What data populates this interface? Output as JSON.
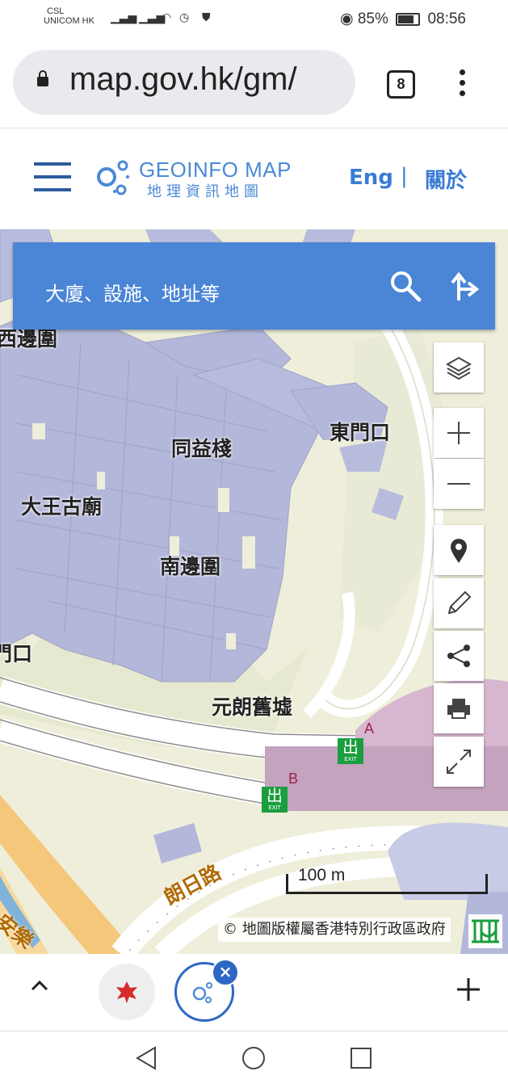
{
  "status_bar": {
    "carrier_line1": "CSL",
    "carrier_line2": "UNICOM HK",
    "battery": "85%",
    "time": "08:56"
  },
  "browser": {
    "url": "map.gov.hk/gm/",
    "tab_count": "8"
  },
  "header": {
    "logo_en": "GEOINFO MAP",
    "logo_zh": "地理資訊地圖",
    "lang_link": "Eng",
    "separator": "|",
    "about_link": "關於"
  },
  "search": {
    "placeholder": "大廈、設施、地址等"
  },
  "map": {
    "labels": [
      "西邊圍",
      "東門口",
      "同益棧",
      "大王古廟",
      "南邊圍",
      "門口",
      "元朗舊墟"
    ],
    "road_labels": [
      "朗日路",
      "安樂"
    ],
    "exit_labels": [
      "A",
      "B"
    ],
    "exit_sign": "出",
    "exit_sign_sub": "EXIT",
    "scale_text": "100 m",
    "copyright": "© 地圖版權屬香港特別行政區政府"
  },
  "colors": {
    "header_blue": "#3a7bd5",
    "search_bar": "#4a85d6",
    "building": "#b3b7d9",
    "station": "#c9a8c2",
    "map_bg": "#eeeeda",
    "exit_green": "#1a9e3e",
    "road_orange": "#f5c77a"
  },
  "controls": [
    "layers-icon",
    "zoom-in-icon",
    "zoom-out-icon",
    "location-pin-icon",
    "pencil-icon",
    "share-icon",
    "print-icon",
    "fullscreen-icon"
  ]
}
